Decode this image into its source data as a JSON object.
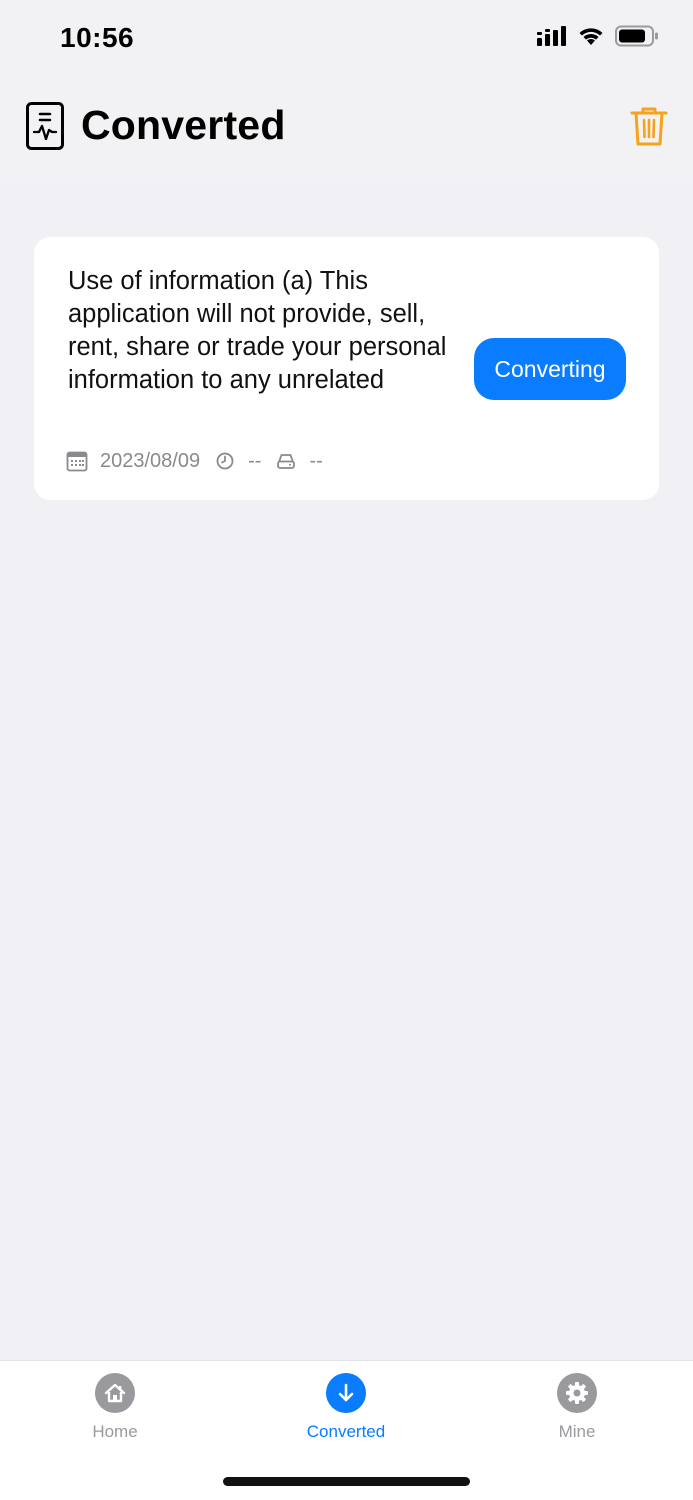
{
  "status_bar": {
    "time": "10:56"
  },
  "header": {
    "title": "Converted"
  },
  "card": {
    "file_name": "Use of information (a) This application will not provide, sell, rent, share or trade your personal information to any unrelated",
    "date": "2023/08/09",
    "duration": "--",
    "size": "--",
    "status_button": "Converting"
  },
  "tabs": [
    {
      "label": "Home",
      "icon": "home-icon",
      "active": false
    },
    {
      "label": "Converted",
      "icon": "download-arrow-icon",
      "active": true
    },
    {
      "label": "Mine",
      "icon": "gear-icon",
      "active": false
    }
  ],
  "colors": {
    "accent": "#0a7cff",
    "trash": "#f5a31a",
    "inactive_tab": "#9a9a9e",
    "background": "#f0f0f5"
  }
}
